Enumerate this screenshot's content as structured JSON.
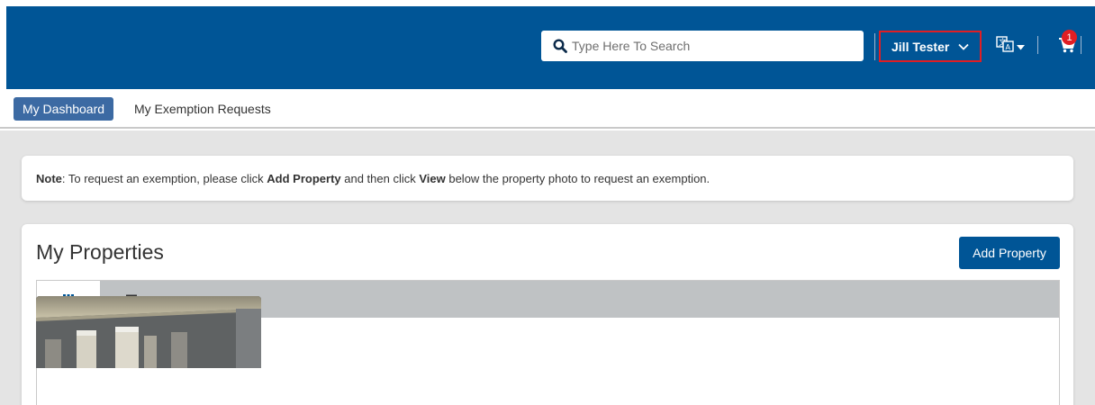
{
  "header": {
    "search": {
      "placeholder": "Type Here To Search",
      "value": ""
    },
    "user": {
      "name": "Jill Tester"
    },
    "cart": {
      "count": "1"
    },
    "icons": {
      "search": "search-icon",
      "user_menu": "chevron-down-icon",
      "language": "translate-icon",
      "cart": "cart-icon"
    },
    "colors": {
      "brand": "#005596",
      "highlight": "#e01e24"
    }
  },
  "subnav": {
    "tabs": [
      {
        "label": "My Dashboard",
        "active": true
      },
      {
        "label": "My Exemption Requests",
        "active": false
      }
    ]
  },
  "note": {
    "prefix": "Note",
    "part1": ": To request an exemption, please click ",
    "add_property": "Add Property",
    "part2": " and then click ",
    "view": "View",
    "part3": " below the property photo to request an exemption."
  },
  "properties": {
    "title": "My Properties",
    "add_button": "Add Property",
    "view_tabs": [
      {
        "icon": "grid-icon",
        "active": true
      },
      {
        "icon": "list-icon",
        "active": false
      }
    ]
  }
}
